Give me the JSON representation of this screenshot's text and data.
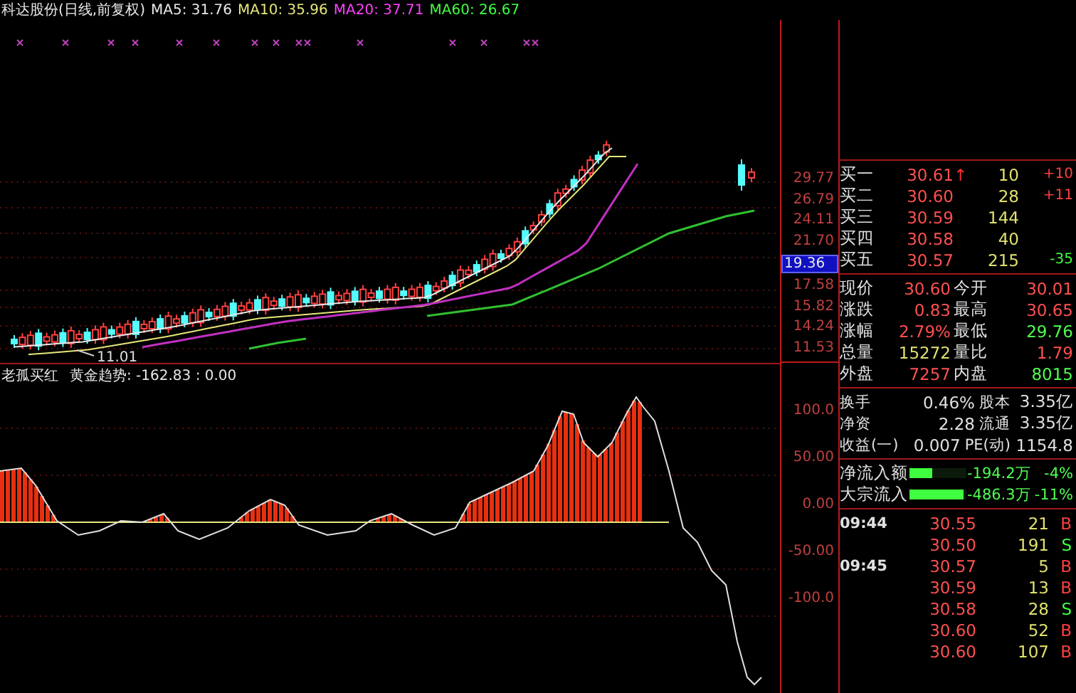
{
  "header": {
    "title": "科达股份(日线,前复权)",
    "averages": [
      {
        "label": "MA5: 31.76",
        "color": "#e8e8e8"
      },
      {
        "label": "MA10: 35.96",
        "color": "#e6e67a"
      },
      {
        "label": "MA20: 37.71",
        "color": "#ff40ff"
      },
      {
        "label": "MA60: 26.67",
        "color": "#40ff40"
      }
    ]
  },
  "price_chart": {
    "low_label": "11.01",
    "axis_labels": [
      {
        "text": "29.77",
        "kind": "tick"
      },
      {
        "text": "26.79",
        "kind": "tick"
      },
      {
        "text": "24.11",
        "kind": "tick"
      },
      {
        "text": "21.70",
        "kind": "tick"
      },
      {
        "text": "19.36",
        "kind": "current"
      },
      {
        "text": "17.58",
        "kind": "tick"
      },
      {
        "text": "15.82",
        "kind": "tick"
      },
      {
        "text": "14.24",
        "kind": "tick"
      },
      {
        "text": "11.53",
        "kind": "tick"
      }
    ]
  },
  "indicator": {
    "name": "老孤买红",
    "reading": "黄金趋势: -162.83 : 0.00",
    "axis_labels": [
      "100.0",
      "50.00",
      "0.00",
      "-50.00",
      "-100.0"
    ]
  },
  "order_book": [
    {
      "label": "买一",
      "price": "30.61",
      "arrow": "↑",
      "volume": "10",
      "change": "+10",
      "color": "#ff4040"
    },
    {
      "label": "买二",
      "price": "30.60",
      "volume": "28",
      "change": "+11",
      "color": "#ff4040"
    },
    {
      "label": "买三",
      "price": "30.59",
      "volume": "144"
    },
    {
      "label": "买四",
      "price": "30.58",
      "volume": "40"
    },
    {
      "label": "买五",
      "price": "30.57",
      "volume": "215",
      "change": "-35",
      "color": "#40ff40"
    }
  ],
  "quotes": [
    {
      "left": {
        "label": "现价",
        "value": "30.60",
        "color": "#ff5050"
      },
      "right": {
        "label": "今开",
        "value": "30.01",
        "color": "#ff5050"
      }
    },
    {
      "left": {
        "label": "涨跌",
        "value": "0.83",
        "color": "#ff5050"
      },
      "right": {
        "label": "最高",
        "value": "30.65",
        "color": "#ff5050"
      }
    },
    {
      "left": {
        "label": "涨幅",
        "value": "2.79%",
        "color": "#ff5050"
      },
      "right": {
        "label": "最低",
        "value": "29.76",
        "color": "#50ff50"
      }
    },
    {
      "left": {
        "label": "总量",
        "value": "15272",
        "color": "#e0e070"
      },
      "right": {
        "label": "量比",
        "value": "1.79",
        "color": "#ff5050"
      }
    },
    {
      "left": {
        "label": "外盘",
        "value": "7257",
        "color": "#ff5050"
      },
      "right": {
        "label": "内盘",
        "value": "8015",
        "color": "#50ff50"
      }
    }
  ],
  "fundamentals": [
    {
      "left": {
        "label": "换手",
        "value": "0.46%"
      },
      "right": {
        "label": "股本",
        "value": "3.35亿"
      }
    },
    {
      "left": {
        "label": "净资",
        "value": "2.28"
      },
      "right": {
        "label": "流通",
        "value": "3.35亿"
      }
    },
    {
      "left": {
        "label": "收益(一)",
        "value": "0.007"
      },
      "right": {
        "label": "PE(动)",
        "value": "1154.8"
      }
    }
  ],
  "fund_flows": [
    {
      "label": "净流入额",
      "level": 0.38,
      "amount": "-194.2万",
      "percent": "-4%"
    },
    {
      "label": "大宗流入",
      "level": 0.95,
      "amount": "-486.3万",
      "percent": "-11%"
    }
  ],
  "trades": [
    {
      "time": "09:44",
      "price": "30.55",
      "volume": "21",
      "side": "B",
      "color": "#ff4040"
    },
    {
      "price": "30.50",
      "volume": "191",
      "side": "S",
      "color": "#40ff40"
    },
    {
      "time": "09:45",
      "price": "30.57",
      "volume": "5",
      "side": "B",
      "color": "#ff4040"
    },
    {
      "price": "30.59",
      "volume": "13",
      "side": "B",
      "color": "#ff4040"
    },
    {
      "price": "30.58",
      "volume": "28",
      "side": "S",
      "color": "#40ff40"
    },
    {
      "price": "30.60",
      "volume": "52",
      "side": "B",
      "color": "#ff4040"
    },
    {
      "price": "30.60",
      "volume": "107",
      "side": "B",
      "color": "#ff4040"
    }
  ]
}
